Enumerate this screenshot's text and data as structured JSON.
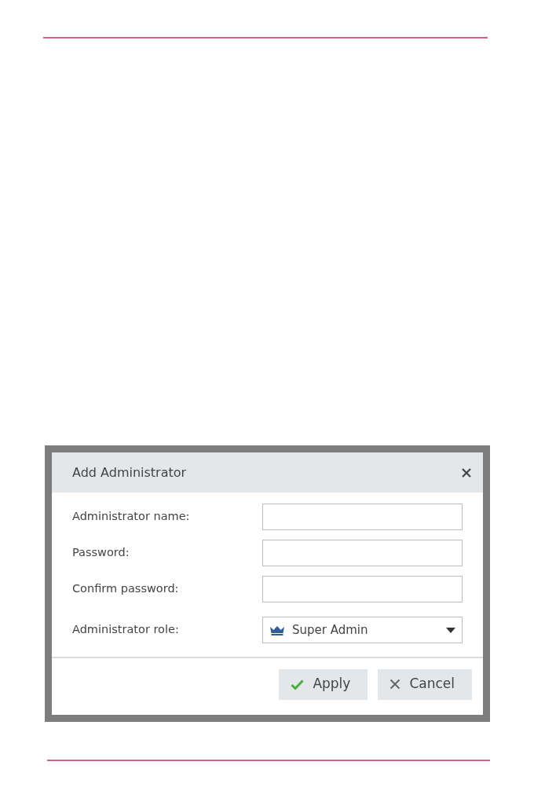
{
  "dialog": {
    "title": "Add Administrator",
    "fields": [
      {
        "kind": "text",
        "label": "Administrator name:"
      },
      {
        "kind": "text",
        "label": "Password:"
      },
      {
        "kind": "text",
        "label": "Confirm password:"
      },
      {
        "kind": "select",
        "label": "Administrator role:",
        "value": "Super Admin"
      }
    ],
    "buttons": [
      {
        "kind": "apply",
        "label": "Apply"
      },
      {
        "kind": "cancel",
        "label": "Cancel"
      }
    ]
  }
}
